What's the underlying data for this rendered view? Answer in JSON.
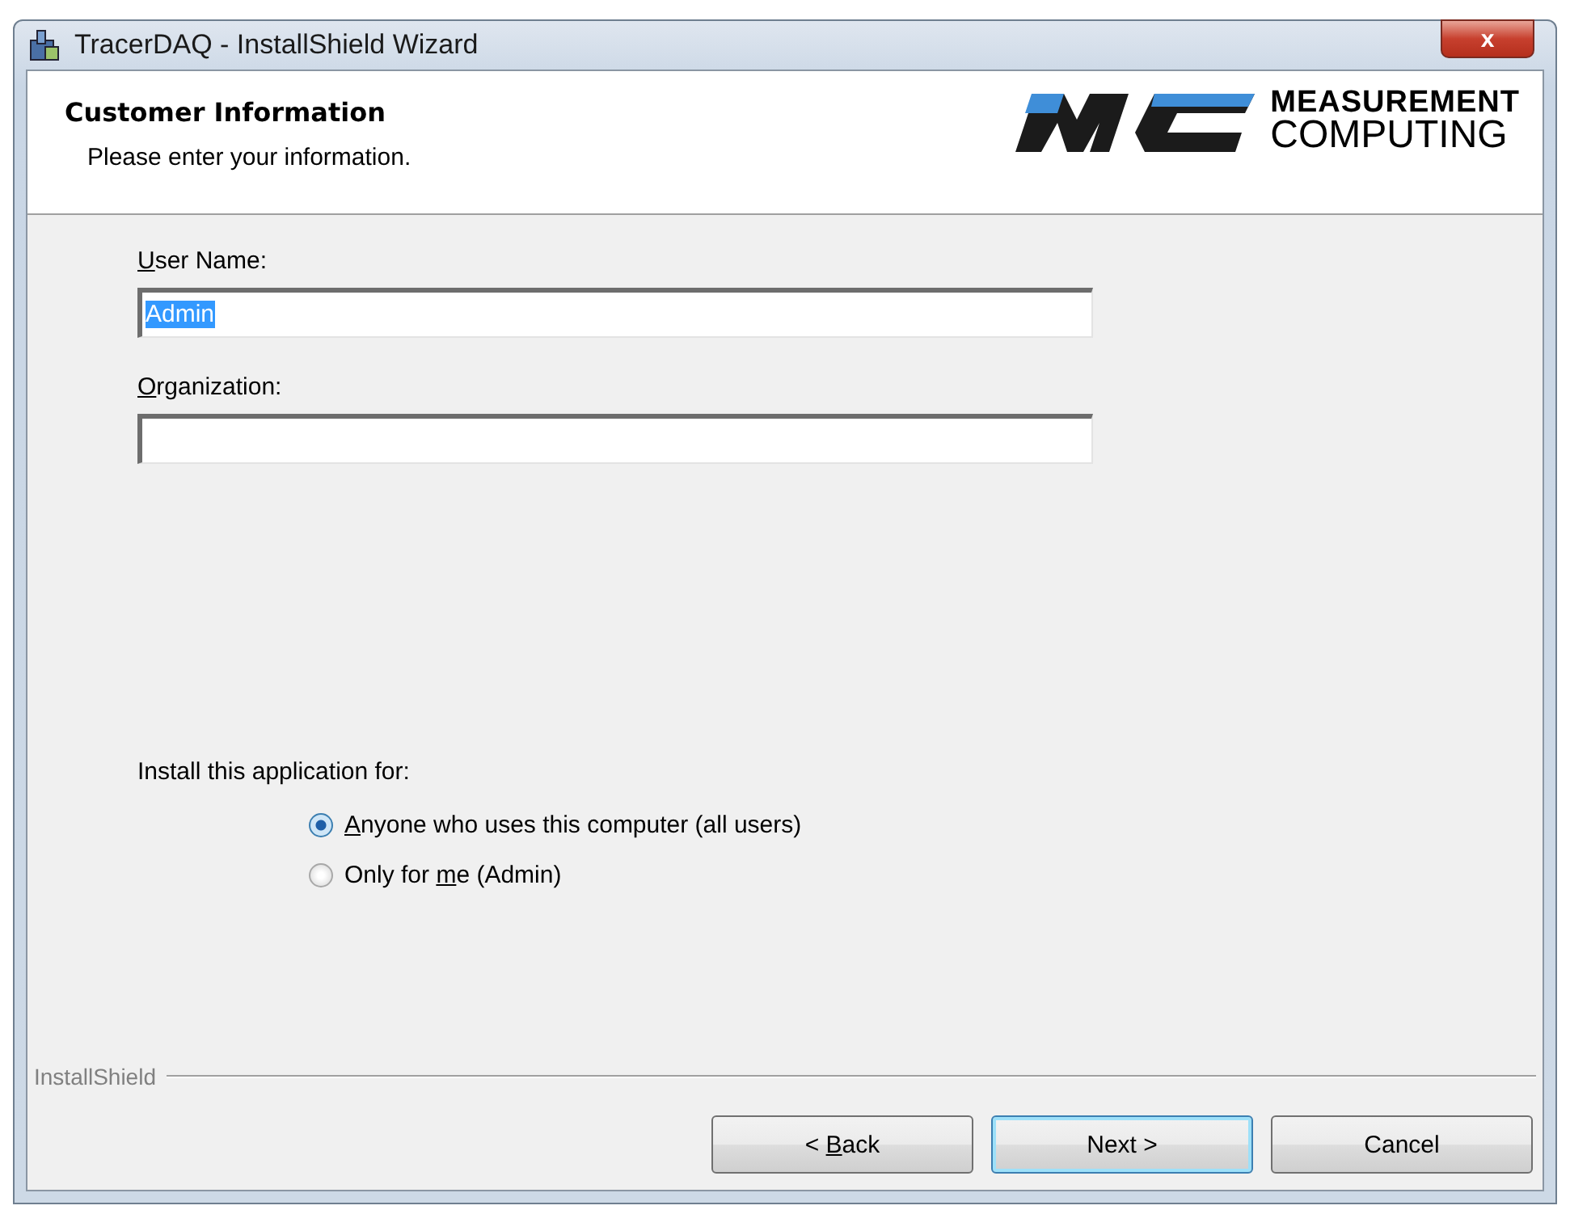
{
  "window": {
    "title": "TracerDAQ - InstallShield Wizard",
    "close": "x"
  },
  "header": {
    "title": "Customer Information",
    "subtitle": "Please enter your information.",
    "logo": [
      "MEASUREMENT",
      "COMPUTING"
    ]
  },
  "fields": [
    {
      "label": {
        "key": "U",
        "post": "ser Name:"
      },
      "value": "Admin",
      "selected_text": true
    },
    {
      "label": {
        "key": "O",
        "post": "rganization:"
      }
    }
  ],
  "install_for": {
    "label": "Install this application for:",
    "options": [
      {
        "label": {
          "key": "A",
          "post": "nyone who uses this computer (all users)"
        },
        "selected": true
      },
      {
        "label": {
          "pre": "Only for ",
          "key": "m",
          "post": "e (Admin)"
        },
        "selected": false
      }
    ]
  },
  "footer": {
    "brand": "InstallShield"
  },
  "buttons": [
    {
      "label": {
        "pre": "< ",
        "key": "B",
        "post": "ack"
      },
      "default": false
    },
    {
      "label": {
        "pre": "Next >"
      },
      "default": true
    },
    {
      "label": {
        "pre": "Cancel"
      },
      "default": false
    }
  ]
}
